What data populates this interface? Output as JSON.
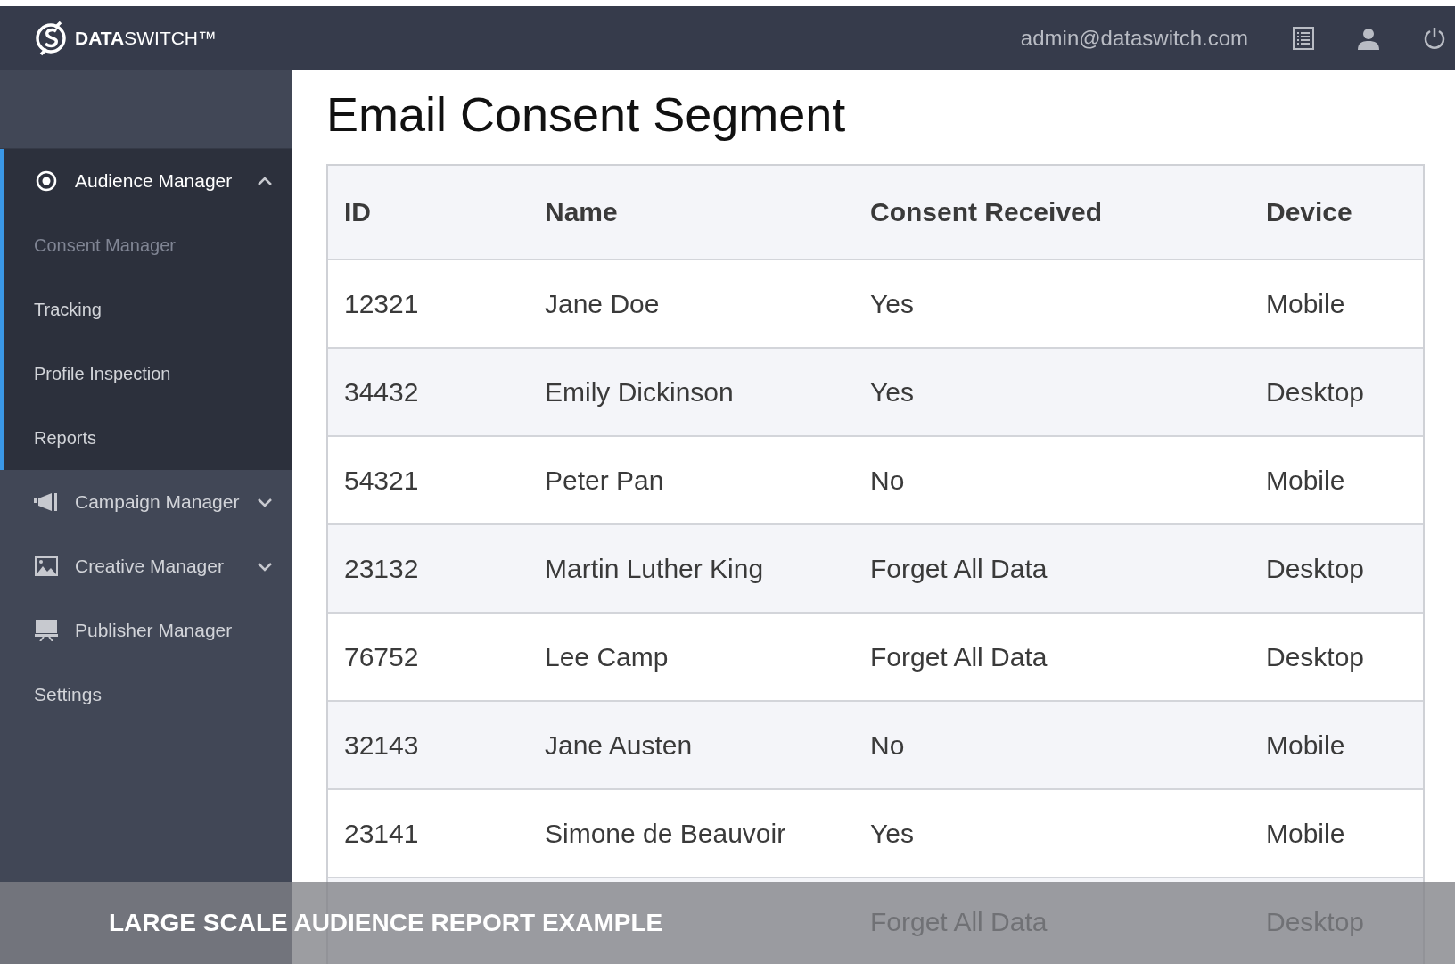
{
  "header": {
    "brand_bold": "DATA",
    "brand_light": "SWITCH™",
    "user_email": "admin@dataswitch.com"
  },
  "sidebar": {
    "items": [
      {
        "label": "Audience Manager",
        "kind": "group",
        "expanded": true,
        "selected": true,
        "children": [
          {
            "label": "Consent Manager",
            "selected": true
          },
          {
            "label": "Tracking",
            "selected": false
          },
          {
            "label": "Profile Inspection",
            "selected": false
          },
          {
            "label": "Reports",
            "selected": false
          }
        ]
      },
      {
        "label": "Campaign Manager",
        "kind": "group",
        "expanded": false,
        "selected": false
      },
      {
        "label": "Creative Manager",
        "kind": "group",
        "expanded": false,
        "selected": false
      },
      {
        "label": "Publisher Manager",
        "kind": "link"
      },
      {
        "label": "Settings",
        "kind": "link"
      }
    ]
  },
  "page_title": "Email Consent Segment",
  "table": {
    "columns": [
      "ID",
      "Name",
      "Consent Received",
      "Device"
    ],
    "rows": [
      [
        "12321",
        "Jane Doe",
        "Yes",
        "Mobile"
      ],
      [
        "34432",
        "Emily Dickinson",
        "Yes",
        "Desktop"
      ],
      [
        "54321",
        "Peter Pan",
        "No",
        "Mobile"
      ],
      [
        "23132",
        "Martin Luther King",
        "Forget All Data",
        "Desktop"
      ],
      [
        "76752",
        "Lee Camp",
        "Forget All Data",
        "Desktop"
      ],
      [
        "32143",
        "Jane Austen",
        "No",
        "Mobile"
      ],
      [
        "23141",
        "Simone de Beauvoir",
        "Yes",
        "Mobile"
      ],
      [
        null,
        null,
        "Forget All Data",
        "Desktop"
      ]
    ]
  },
  "caption": "LARGE SCALE AUDIENCE REPORT EXAMPLE"
}
